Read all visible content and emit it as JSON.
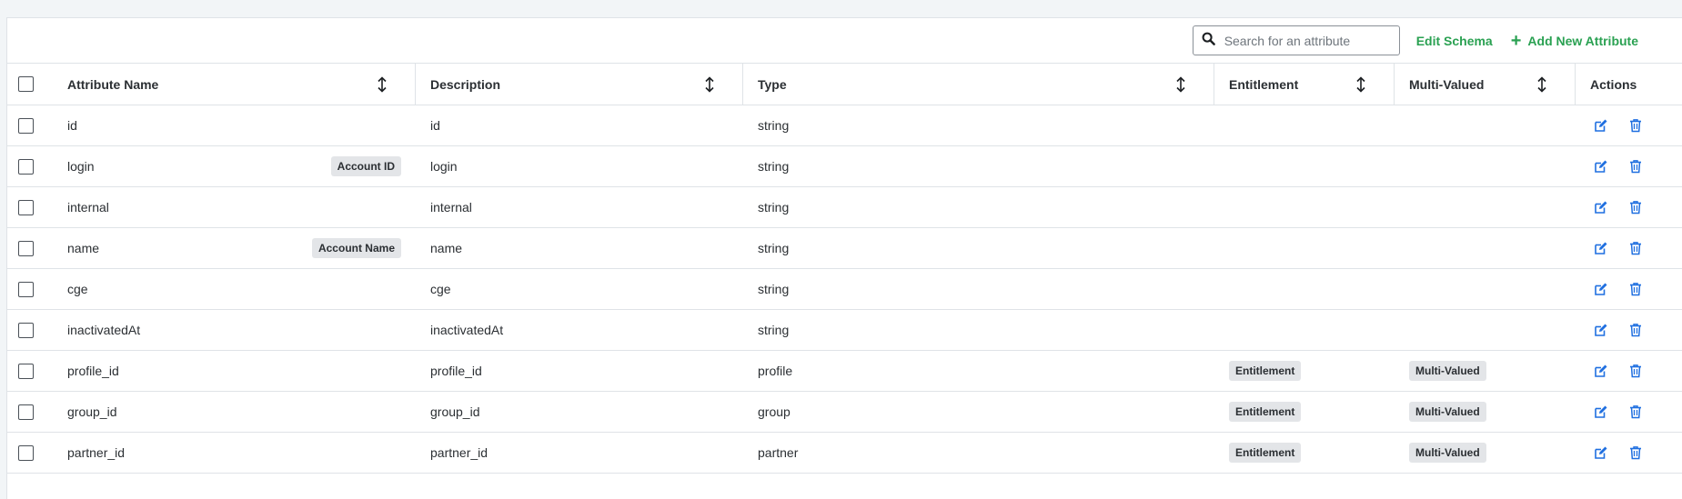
{
  "toolbar": {
    "search_placeholder": "Search for an attribute",
    "search_value": "",
    "edit_schema_label": "Edit Schema",
    "add_attribute_label": "Add New Attribute"
  },
  "colors": {
    "accent_green": "#2aa152",
    "action_blue": "#1f6fe0",
    "badge_bg": "#e3e5e8"
  },
  "icons": {
    "search": "search-icon",
    "add": "plus-icon",
    "sort": "sort-arrows-icon",
    "edit": "edit-icon",
    "delete": "trash-icon"
  },
  "table": {
    "headers": {
      "attribute_name": "Attribute Name",
      "description": "Description",
      "type": "Type",
      "entitlement": "Entitlement",
      "multi_valued": "Multi-Valued",
      "actions": "Actions"
    },
    "rows": [
      {
        "name": "id",
        "tag": "",
        "description": "id",
        "type": "string",
        "entitlement": "",
        "multi_valued": ""
      },
      {
        "name": "login",
        "tag": "Account ID",
        "description": "login",
        "type": "string",
        "entitlement": "",
        "multi_valued": ""
      },
      {
        "name": "internal",
        "tag": "",
        "description": "internal",
        "type": "string",
        "entitlement": "",
        "multi_valued": ""
      },
      {
        "name": "name",
        "tag": "Account Name",
        "description": "name",
        "type": "string",
        "entitlement": "",
        "multi_valued": ""
      },
      {
        "name": "cge",
        "tag": "",
        "description": "cge",
        "type": "string",
        "entitlement": "",
        "multi_valued": ""
      },
      {
        "name": "inactivatedAt",
        "tag": "",
        "description": "inactivatedAt",
        "type": "string",
        "entitlement": "",
        "multi_valued": ""
      },
      {
        "name": "profile_id",
        "tag": "",
        "description": "profile_id",
        "type": "profile",
        "entitlement": "Entitlement",
        "multi_valued": "Multi-Valued"
      },
      {
        "name": "group_id",
        "tag": "",
        "description": "group_id",
        "type": "group",
        "entitlement": "Entitlement",
        "multi_valued": "Multi-Valued"
      },
      {
        "name": "partner_id",
        "tag": "",
        "description": "partner_id",
        "type": "partner",
        "entitlement": "Entitlement",
        "multi_valued": "Multi-Valued"
      }
    ]
  }
}
